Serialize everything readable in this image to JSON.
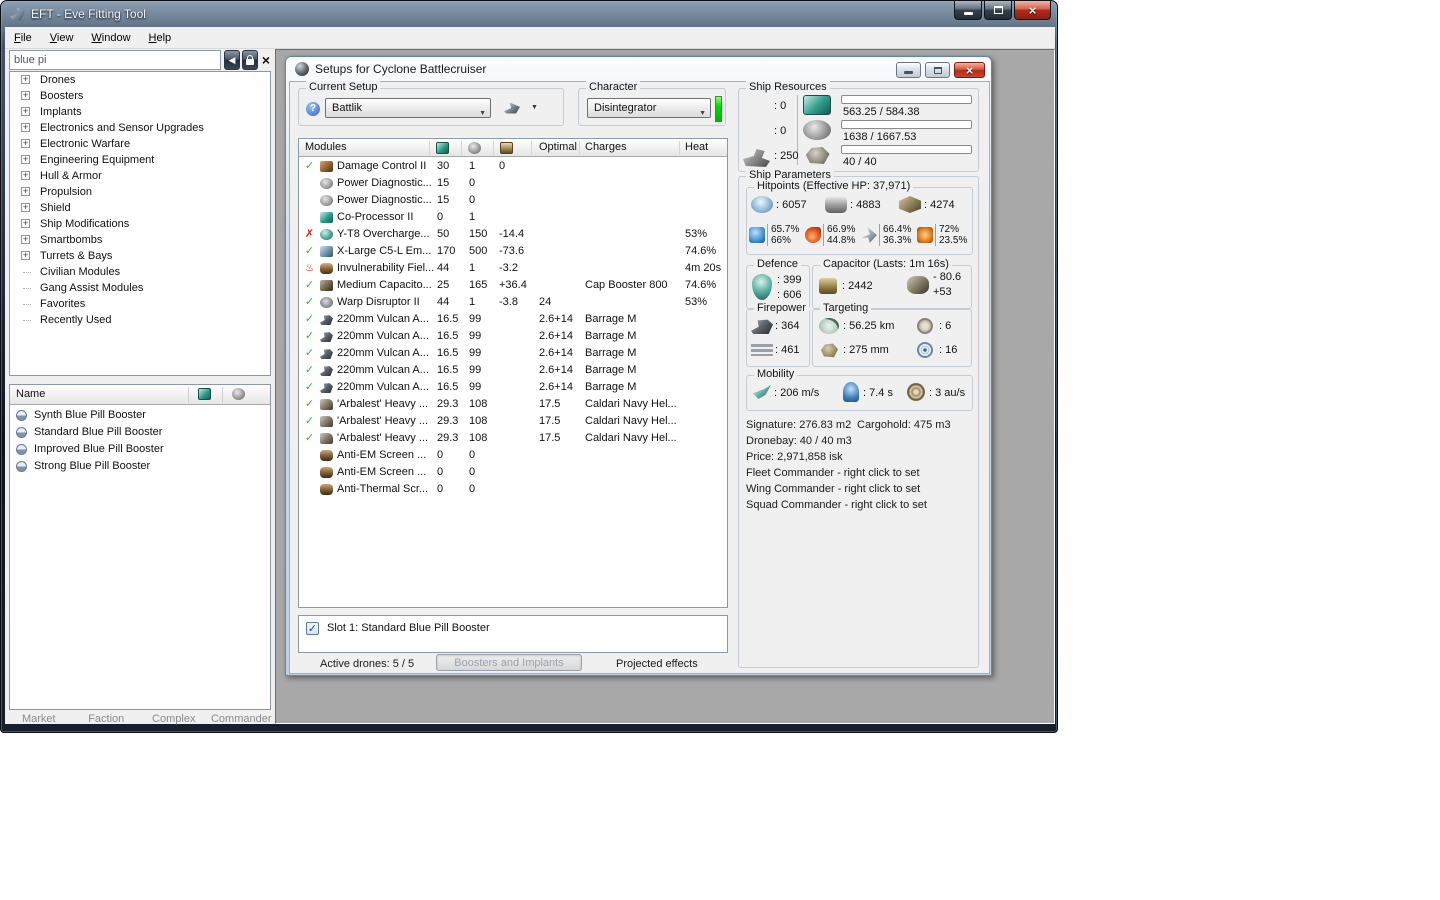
{
  "window": {
    "title": "EFT - Eve Fitting Tool",
    "menu": [
      "File",
      "View",
      "Window",
      "Help"
    ]
  },
  "sidebar": {
    "search_value": "blue pi",
    "tree": [
      {
        "label": "Drones",
        "expandable": true
      },
      {
        "label": "Boosters",
        "expandable": true
      },
      {
        "label": "Implants",
        "expandable": true
      },
      {
        "label": "Electronics and Sensor Upgrades",
        "expandable": true
      },
      {
        "label": "Electronic Warfare",
        "expandable": true
      },
      {
        "label": "Engineering Equipment",
        "expandable": true
      },
      {
        "label": "Hull & Armor",
        "expandable": true
      },
      {
        "label": "Propulsion",
        "expandable": true
      },
      {
        "label": "Shield",
        "expandable": true
      },
      {
        "label": "Ship Modifications",
        "expandable": true
      },
      {
        "label": "Smartbombs",
        "expandable": true
      },
      {
        "label": "Turrets & Bays",
        "expandable": true
      },
      {
        "label": "Civilian Modules",
        "expandable": false
      },
      {
        "label": "Gang Assist Modules",
        "expandable": false
      },
      {
        "label": "Favorites",
        "expandable": false
      },
      {
        "label": "Recently Used",
        "expandable": false
      }
    ],
    "results": {
      "name_header": "Name",
      "items": [
        "Synth Blue Pill Booster",
        "Standard Blue Pill Booster",
        "Improved Blue Pill Booster",
        "Strong Blue Pill Booster"
      ]
    },
    "bottom_tabs": [
      "Market",
      "Faction",
      "Complex",
      "Commander"
    ]
  },
  "setup_window": {
    "title": "Setups for Cyclone Battlecruiser",
    "current_setup": {
      "label": "Current Setup",
      "value": "Battlik"
    },
    "character": {
      "label": "Character",
      "value": "Disintegrator"
    },
    "ship_resources": {
      "label": "Ship Resources",
      "slots": [
        {
          "icon": "turret-hardpoint-icon",
          "value": "0"
        },
        {
          "icon": "launcher-hardpoint-icon",
          "value": "0"
        },
        {
          "icon": "rig-slot-icon",
          "value": "250"
        }
      ],
      "bars": [
        {
          "icon": "cpu-icon",
          "text": "563.25 / 584.38",
          "pct": 96.4
        },
        {
          "icon": "powergrid-icon",
          "text": "1638 / 1667.53",
          "pct": 98.2
        },
        {
          "icon": "dronebay-icon",
          "text": "40 / 40",
          "pct": 100
        }
      ]
    },
    "modules": {
      "headers": {
        "name": "Modules",
        "optimal": "Optimal",
        "charges": "Charges",
        "heat": "Heat"
      },
      "rows": [
        {
          "status": "ok",
          "icon": "damage-control-icon",
          "name": "Damage Control II",
          "cpu": "30",
          "pg": "1",
          "cap": "0",
          "optimal": "",
          "charges": "",
          "heat": ""
        },
        {
          "status": "none",
          "icon": "power-diagnostic-icon",
          "name": "Power Diagnostic...",
          "cpu": "15",
          "pg": "0",
          "cap": "",
          "optimal": "",
          "charges": "",
          "heat": ""
        },
        {
          "status": "none",
          "icon": "power-diagnostic-icon",
          "name": "Power Diagnostic...",
          "cpu": "15",
          "pg": "0",
          "cap": "",
          "optimal": "",
          "charges": "",
          "heat": ""
        },
        {
          "status": "none",
          "icon": "co-processor-icon",
          "name": "Co-Processor II",
          "cpu": "0",
          "pg": "1",
          "cap": "",
          "optimal": "",
          "charges": "",
          "heat": ""
        },
        {
          "status": "error",
          "icon": "afterburner-icon",
          "name": "Y-T8 Overcharge...",
          "cpu": "50",
          "pg": "150",
          "cap": "-14.4",
          "optimal": "",
          "charges": "",
          "heat": "53%"
        },
        {
          "status": "ok",
          "icon": "shield-booster-icon",
          "name": "X-Large C5-L Em...",
          "cpu": "170",
          "pg": "500",
          "cap": "-73.6",
          "optimal": "",
          "charges": "",
          "heat": "74.6%"
        },
        {
          "status": "overheat",
          "icon": "invulnerability-field-icon",
          "name": "Invulnerability Fiel...",
          "cpu": "44",
          "pg": "1",
          "cap": "-3.2",
          "optimal": "",
          "charges": "",
          "heat": "4m 20s"
        },
        {
          "status": "ok",
          "icon": "cap-booster-icon",
          "name": "Medium Capacito...",
          "cpu": "25",
          "pg": "165",
          "cap": "+36.4",
          "optimal": "",
          "charges": "Cap Booster 800",
          "heat": "74.6%"
        },
        {
          "status": "ok",
          "icon": "warp-disruptor-icon",
          "name": "Warp Disruptor II",
          "cpu": "44",
          "pg": "1",
          "cap": "-3.8",
          "optimal": "24",
          "charges": "",
          "heat": "53%"
        },
        {
          "status": "ok",
          "icon": "autocannon-icon",
          "name": "220mm Vulcan A...",
          "cpu": "16.5",
          "pg": "99",
          "cap": "",
          "optimal": "2.6+14",
          "charges": "Barrage M",
          "heat": ""
        },
        {
          "status": "ok",
          "icon": "autocannon-icon",
          "name": "220mm Vulcan A...",
          "cpu": "16.5",
          "pg": "99",
          "cap": "",
          "optimal": "2.6+14",
          "charges": "Barrage M",
          "heat": ""
        },
        {
          "status": "ok",
          "icon": "autocannon-icon",
          "name": "220mm Vulcan A...",
          "cpu": "16.5",
          "pg": "99",
          "cap": "",
          "optimal": "2.6+14",
          "charges": "Barrage M",
          "heat": ""
        },
        {
          "status": "ok",
          "icon": "autocannon-icon",
          "name": "220mm Vulcan A...",
          "cpu": "16.5",
          "pg": "99",
          "cap": "",
          "optimal": "2.6+14",
          "charges": "Barrage M",
          "heat": ""
        },
        {
          "status": "ok",
          "icon": "autocannon-icon",
          "name": "220mm Vulcan A...",
          "cpu": "16.5",
          "pg": "99",
          "cap": "",
          "optimal": "2.6+14",
          "charges": "Barrage M",
          "heat": ""
        },
        {
          "status": "ok",
          "icon": "missile-launcher-icon",
          "name": "'Arbalest' Heavy ...",
          "cpu": "29.3",
          "pg": "108",
          "cap": "",
          "optimal": "17.5",
          "charges": "Caldari Navy Hel...",
          "heat": ""
        },
        {
          "status": "ok",
          "icon": "missile-launcher-icon",
          "name": "'Arbalest' Heavy ...",
          "cpu": "29.3",
          "pg": "108",
          "cap": "",
          "optimal": "17.5",
          "charges": "Caldari Navy Hel...",
          "heat": ""
        },
        {
          "status": "ok",
          "icon": "missile-launcher-icon",
          "name": "'Arbalest' Heavy ...",
          "cpu": "29.3",
          "pg": "108",
          "cap": "",
          "optimal": "17.5",
          "charges": "Caldari Navy Hel...",
          "heat": ""
        },
        {
          "status": "none",
          "icon": "rig-icon",
          "name": "Anti-EM Screen ...",
          "cpu": "0",
          "pg": "0",
          "cap": "",
          "optimal": "",
          "charges": "",
          "heat": ""
        },
        {
          "status": "none",
          "icon": "rig-icon",
          "name": "Anti-EM Screen ...",
          "cpu": "0",
          "pg": "0",
          "cap": "",
          "optimal": "",
          "charges": "",
          "heat": ""
        },
        {
          "status": "none",
          "icon": "rig-icon",
          "name": "Anti-Thermal Scr...",
          "cpu": "0",
          "pg": "0",
          "cap": "",
          "optimal": "",
          "charges": "",
          "heat": ""
        }
      ]
    },
    "booster_slot": {
      "checked": true,
      "label": "Slot 1: Standard Blue Pill Booster"
    },
    "bottom_tabs": {
      "drones": "Active drones: 5 / 5",
      "boosters": "Boosters and Implants",
      "projected": "Projected effects"
    },
    "ship_parameters": {
      "label": "Ship Parameters",
      "hitpoints": {
        "label": "Hitpoints (Effective HP: 37,971)",
        "shield": "6057",
        "armor": "4883",
        "structure": "4274",
        "resists": [
          {
            "type": "em",
            "top": "65.7%",
            "bottom": "66%"
          },
          {
            "type": "thermal",
            "top": "66.9%",
            "bottom": "44.8%"
          },
          {
            "type": "kinetic",
            "top": "66.4%",
            "bottom": "36.3%"
          },
          {
            "type": "explosive",
            "top": "72%",
            "bottom": "23.5%"
          }
        ]
      },
      "defence": {
        "label": "Defence",
        "top": "399",
        "bottom": "606"
      },
      "capacitor": {
        "label": "Capacitor (Lasts: 1m 16s)",
        "amount": "2442",
        "delta_top": "- 80.6",
        "delta_bottom": "+53"
      },
      "firepower": {
        "label": "Firepower",
        "dps": "364",
        "volley": "461"
      },
      "targeting": {
        "label": "Targeting",
        "range": "56.25 km",
        "max_targets": "6",
        "resolution": "275 mm",
        "sensor": "16"
      },
      "mobility": {
        "label": "Mobility",
        "speed": "206 m/s",
        "align": "7.4 s",
        "warp": "3 au/s"
      },
      "info": {
        "signature": "Signature: 276.83 m2",
        "cargohold": "Cargohold: 475 m3",
        "lines": [
          "Dronebay: 40 / 40 m3",
          "Price: 2,971,858 isk",
          "Fleet Commander - right click to set",
          "Wing Commander - right click to set",
          "Squad Commander - right click to set"
        ]
      }
    }
  }
}
